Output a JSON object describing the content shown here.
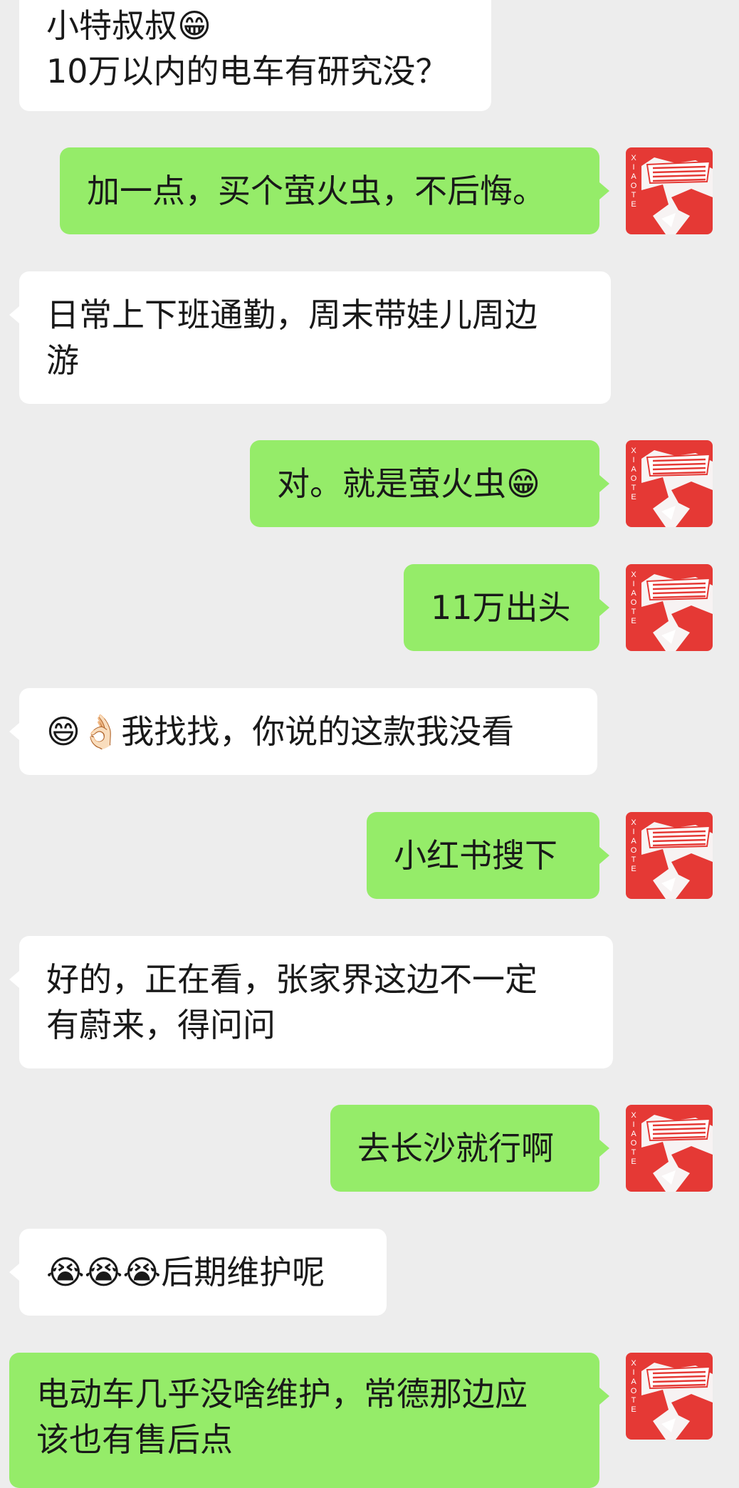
{
  "colors": {
    "background": "#ededed",
    "incoming_bubble": "#ffffff",
    "outgoing_bubble": "#95ec69",
    "text": "#191919",
    "avatar_red": "#e53935"
  },
  "messages": [
    {
      "side": "in",
      "text": "小特叔叔😁\n10万以内的电车有研究没？"
    },
    {
      "side": "out",
      "text": "加一点，买个萤火虫，不后悔。"
    },
    {
      "side": "in",
      "text": "日常上下班通勤，周末带娃儿周边\n游"
    },
    {
      "side": "out",
      "text": "对。就是萤火虫😁"
    },
    {
      "side": "out",
      "text": "11万出头"
    },
    {
      "side": "in",
      "text": "😄👌🏻我找找，你说的这款我没看"
    },
    {
      "side": "out",
      "text": "小红书搜下"
    },
    {
      "side": "in",
      "text": "好的，正在看，张家界这边不一定\n有蔚来，得问问"
    },
    {
      "side": "out",
      "text": "去长沙就行啊"
    },
    {
      "side": "in",
      "text": "😭😭😭后期维护呢"
    },
    {
      "side": "out",
      "text": "电动车几乎没啥维护，常德那边应\n该也有售后点"
    }
  ],
  "avatar": {
    "label": "XIAOTE",
    "icon": "sunglasses-avatar-icon"
  }
}
